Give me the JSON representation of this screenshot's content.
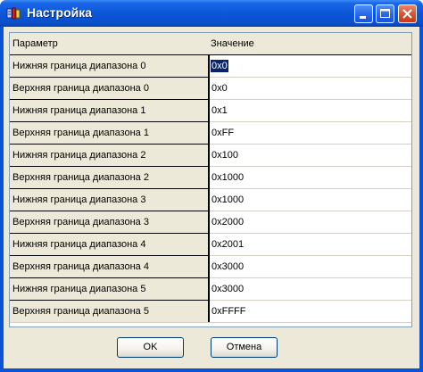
{
  "window": {
    "title": "Настройка",
    "icon": "app-icon"
  },
  "colors": {
    "titlebar": "#0b57d8",
    "face": "#ece9d8",
    "selection": "#0a246a"
  },
  "table": {
    "headers": {
      "name": "Параметр",
      "value": "Значение"
    },
    "rows": [
      {
        "name": "Нижняя граница диапазона 0",
        "value": "0x0",
        "selected": true
      },
      {
        "name": "Верхняя граница диапазона 0",
        "value": "0x0"
      },
      {
        "name": "Нижняя граница диапазона 1",
        "value": "0x1"
      },
      {
        "name": "Верхняя граница диапазона 1",
        "value": "0xFF"
      },
      {
        "name": "Нижняя граница диапазона 2",
        "value": "0x100"
      },
      {
        "name": "Верхняя граница диапазона 2",
        "value": "0x1000"
      },
      {
        "name": "Нижняя граница диапазона 3",
        "value": "0x1000"
      },
      {
        "name": "Верхняя граница диапазона 3",
        "value": "0x2000"
      },
      {
        "name": "Нижняя граница диапазона 4",
        "value": "0x2001"
      },
      {
        "name": "Верхняя граница диапазона 4",
        "value": "0x3000"
      },
      {
        "name": "Нижняя граница диапазона 5",
        "value": "0x3000"
      },
      {
        "name": "Верхняя граница диапазона 5",
        "value": "0xFFFF"
      }
    ]
  },
  "buttons": {
    "ok": "OK",
    "cancel": "Отмена"
  }
}
